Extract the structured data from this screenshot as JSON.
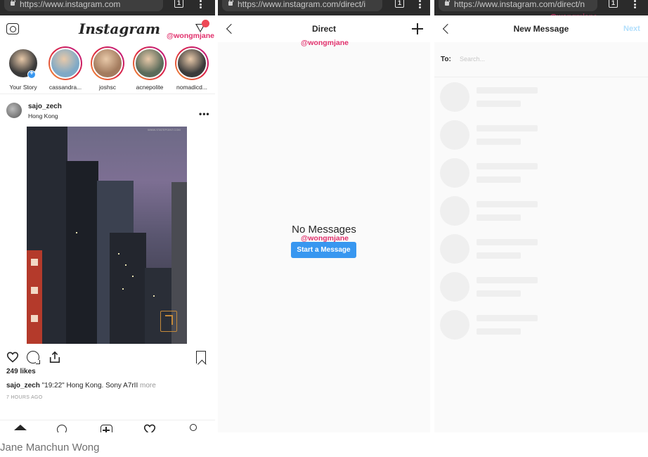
{
  "browser": {
    "panel1_url": "https://www.instagram.com",
    "panel2_url": "https://www.instagram.com/direct/i",
    "panel3_url": "https://www.instagram.com/direct/n",
    "tab_count": "1"
  },
  "feed": {
    "brand": "Instagram",
    "watermark": "@wongmjane",
    "stories": [
      {
        "name": "Your Story",
        "own": true,
        "color": "#3a3a3a"
      },
      {
        "name": "cassandra...",
        "own": false,
        "color": "#7fa9c6"
      },
      {
        "name": "joshsc",
        "own": false,
        "color": "#a37b5e"
      },
      {
        "name": "acnepolite",
        "own": false,
        "color": "#5b6b5a"
      },
      {
        "name": "nomadicd...",
        "own": false,
        "color": "#3b3b3b"
      }
    ],
    "post": {
      "username": "sajo_zech",
      "location": "Hong Kong",
      "photo_tag": "WWW.STATEPOINT.COM",
      "likes": "249 likes",
      "caption_user": "sajo_zech",
      "caption_text": " \"19:22\" Hong Kong. Sony A7rII ",
      "more_label": "more",
      "time": "7 HOURS AGO"
    },
    "icons": [
      "camera-icon",
      "filter-icon",
      "more-icon",
      "heart-icon",
      "comment-icon",
      "share-icon",
      "save-icon",
      "home-icon",
      "search-icon",
      "add-icon",
      "activity-icon",
      "profile-icon"
    ]
  },
  "direct": {
    "title": "Direct",
    "watermark": "@wongmjane",
    "empty_title": "No Messages",
    "empty_watermark": "@wongmjane",
    "start_button": "Start a Message"
  },
  "new_message": {
    "title": "New Message",
    "watermark": "@wongmjane",
    "next_label": "Next",
    "to_label": "To:",
    "search_placeholder": "Search...",
    "search_value": ""
  },
  "credit": "Jane Manchun Wong",
  "colors": {
    "accent_blue": "#3897f0",
    "badge_red": "#ed4956",
    "watermark_pink": "#e1306c",
    "next_disabled": "#b2dffc"
  }
}
